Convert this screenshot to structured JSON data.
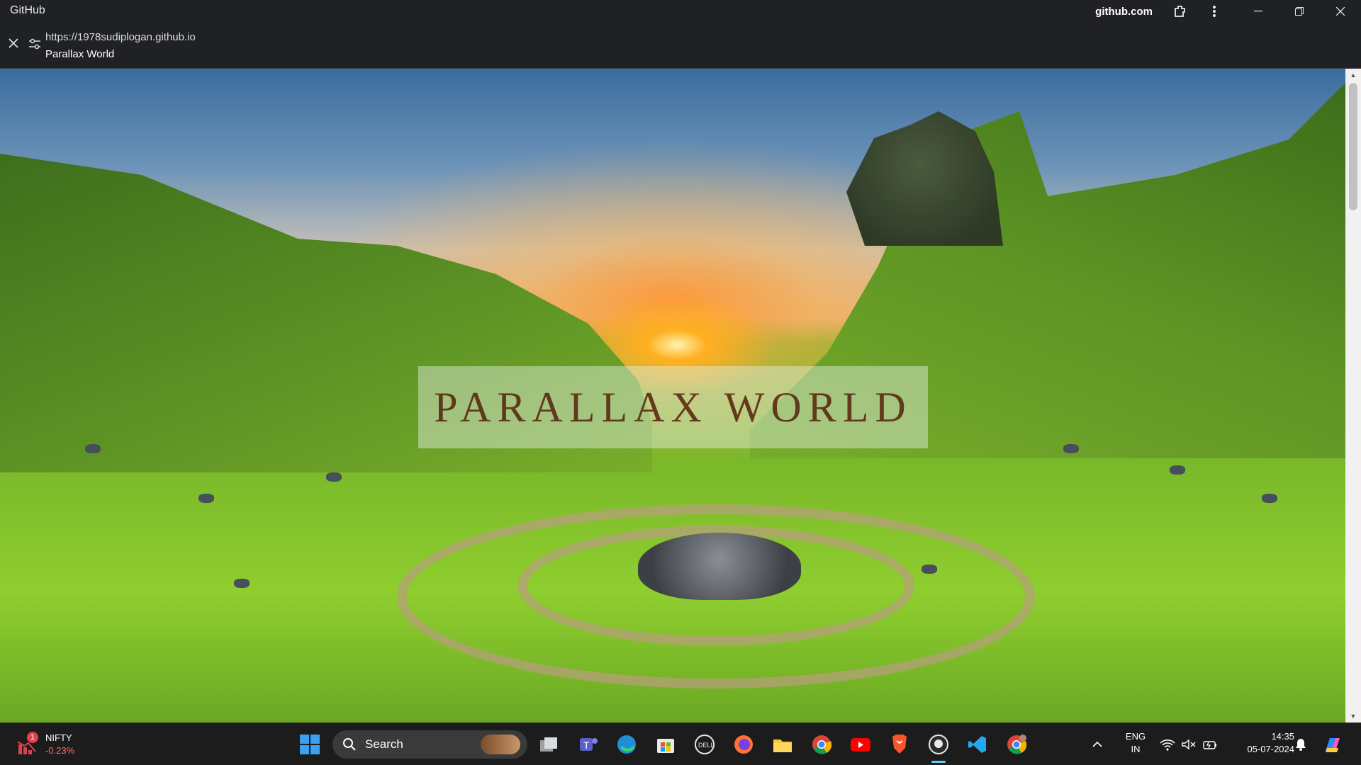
{
  "titlebar": {
    "app_title": "GitHub",
    "domain": "github.com",
    "url": "https://1978sudiplogan.github.io",
    "page_title": "Parallax World"
  },
  "page": {
    "hero_heading": "PARALLAX WORLD"
  },
  "taskbar": {
    "widget": {
      "name": "NIFTY",
      "value": "-0.23%",
      "badge": "1"
    },
    "search_label": "Search",
    "apps": [
      "task-view",
      "teams",
      "edge",
      "store",
      "dell",
      "firefox",
      "file-explorer",
      "chrome",
      "youtube",
      "brave",
      "github-desktop",
      "vscode",
      "chrome-profile"
    ],
    "lang_line1": "ENG",
    "lang_line2": "IN",
    "time": "14:35",
    "date": "05-07-2024"
  },
  "colors": {
    "titlebar_bg": "#202124",
    "taskbar_bg": "#1c1c1c",
    "heading_color": "#5a2a12",
    "negative": "#ff6b6b"
  }
}
